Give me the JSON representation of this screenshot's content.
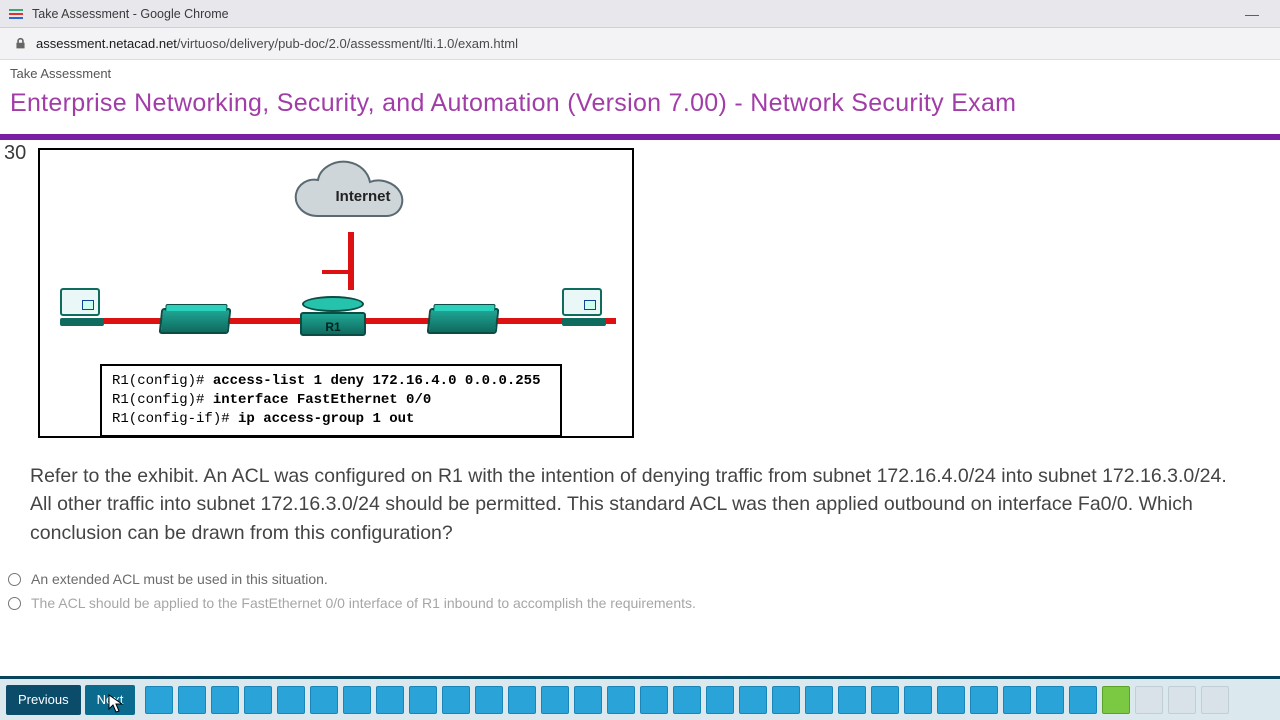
{
  "window": {
    "title": "Take Assessment - Google Chrome",
    "minimize": "—"
  },
  "address": {
    "host": "assessment.netacad.net",
    "path": "/virtuoso/delivery/pub-doc/2.0/assessment/lti.1.0/exam.html"
  },
  "page": {
    "breadcrumb": "Take Assessment",
    "exam_title": "Enterprise Networking, Security, and Automation (Version 7.00) - Network Security Exam"
  },
  "question": {
    "number": "30",
    "diagram": {
      "cloud_label": "Internet",
      "router_label": "R1",
      "config_lines": [
        {
          "prompt": "R1(config)# ",
          "cmd": "access-list 1 deny 172.16.4.0 0.0.0.255"
        },
        {
          "prompt": "R1(config)# ",
          "cmd": "interface FastEthernet 0/0"
        },
        {
          "prompt": "R1(config-if)# ",
          "cmd": "ip access-group 1 out"
        }
      ]
    },
    "text": "Refer to the exhibit. An ACL was configured on R1 with the intention of denying traffic from subnet 172.16.4.0/24 into subnet 172.16.3.0/24. All other traffic into subnet 172.16.3.0/24 should be permitted. This standard ACL was then applied outbound on interface Fa0/0. Which conclusion can be drawn from this configuration?",
    "options": [
      "An extended ACL must be used in this situation.",
      "The ACL should be applied to the FastEthernet 0/0 interface of R1 inbound to accomplish the requirements."
    ]
  },
  "nav": {
    "previous": "Previous",
    "next": "Next",
    "total_squares": 33,
    "current_index": 29,
    "answered_up_to": 29
  }
}
